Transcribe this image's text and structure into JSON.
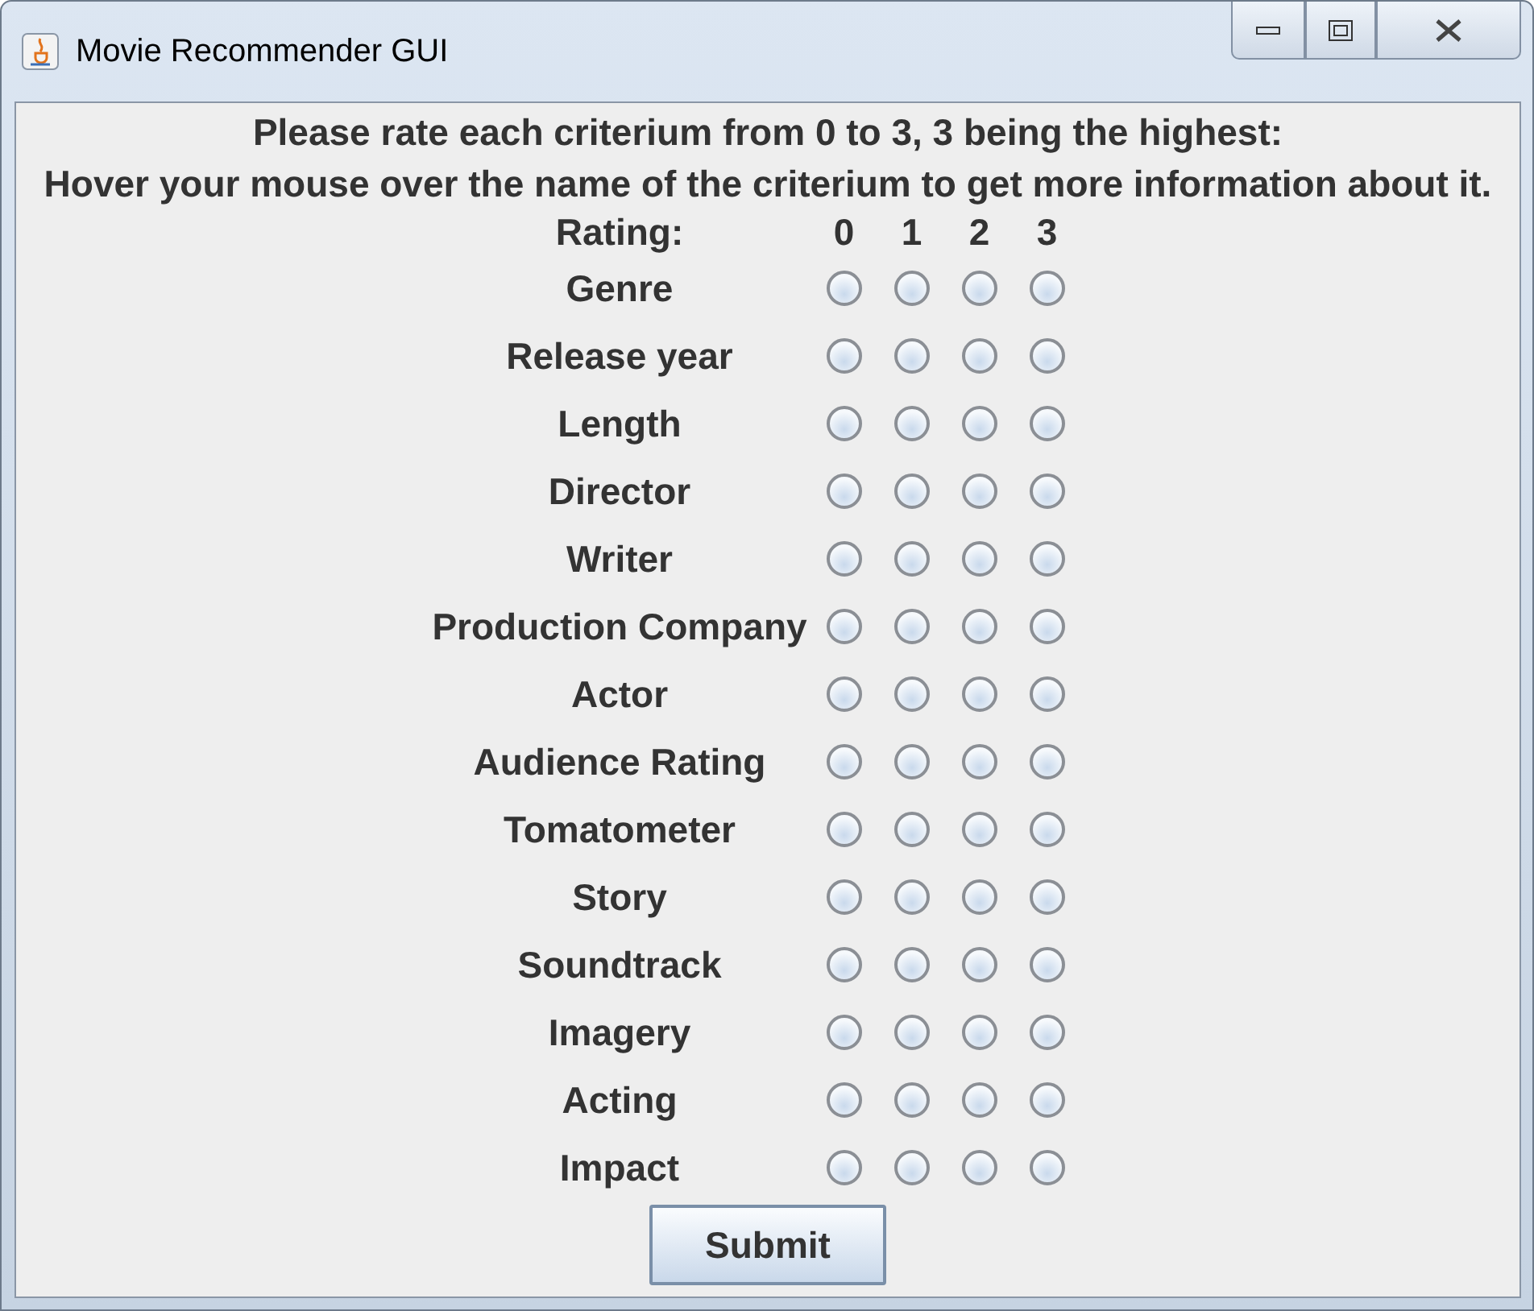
{
  "window": {
    "title": "Movie Recommender GUI"
  },
  "instructions": [
    "Please rate each criterium from 0 to 3, 3 being the highest:",
    "Hover your mouse over the name of the criterium to get more information about it."
  ],
  "rating_header": {
    "label": "Rating:",
    "values": [
      "0",
      "1",
      "2",
      "3"
    ]
  },
  "criteria": [
    {
      "name": "Genre",
      "options": [
        {
          "selected": false
        },
        {
          "selected": false
        },
        {
          "selected": false
        },
        {
          "selected": false
        }
      ]
    },
    {
      "name": "Release year",
      "options": [
        {
          "selected": false
        },
        {
          "selected": false
        },
        {
          "selected": false
        },
        {
          "selected": false
        }
      ]
    },
    {
      "name": "Length",
      "options": [
        {
          "selected": false
        },
        {
          "selected": false
        },
        {
          "selected": false
        },
        {
          "selected": false
        }
      ]
    },
    {
      "name": "Director",
      "options": [
        {
          "selected": false
        },
        {
          "selected": false
        },
        {
          "selected": false
        },
        {
          "selected": false
        }
      ]
    },
    {
      "name": "Writer",
      "options": [
        {
          "selected": false
        },
        {
          "selected": false
        },
        {
          "selected": false
        },
        {
          "selected": false
        }
      ]
    },
    {
      "name": "Production Company",
      "options": [
        {
          "selected": false
        },
        {
          "selected": false
        },
        {
          "selected": false
        },
        {
          "selected": false
        }
      ]
    },
    {
      "name": "Actor",
      "options": [
        {
          "selected": false
        },
        {
          "selected": false
        },
        {
          "selected": false
        },
        {
          "selected": false
        }
      ]
    },
    {
      "name": "Audience Rating",
      "options": [
        {
          "selected": false
        },
        {
          "selected": false
        },
        {
          "selected": false
        },
        {
          "selected": false
        }
      ]
    },
    {
      "name": "Tomatometer",
      "options": [
        {
          "selected": false
        },
        {
          "selected": false
        },
        {
          "selected": false
        },
        {
          "selected": false
        }
      ]
    },
    {
      "name": "Story",
      "options": [
        {
          "selected": false
        },
        {
          "selected": false
        },
        {
          "selected": false
        },
        {
          "selected": false
        }
      ]
    },
    {
      "name": "Soundtrack",
      "options": [
        {
          "selected": false
        },
        {
          "selected": false
        },
        {
          "selected": false
        },
        {
          "selected": false
        }
      ]
    },
    {
      "name": "Imagery",
      "options": [
        {
          "selected": false
        },
        {
          "selected": false
        },
        {
          "selected": false
        },
        {
          "selected": false
        }
      ]
    },
    {
      "name": "Acting",
      "options": [
        {
          "selected": false
        },
        {
          "selected": false
        },
        {
          "selected": false
        },
        {
          "selected": false
        }
      ]
    },
    {
      "name": "Impact",
      "options": [
        {
          "selected": false
        },
        {
          "selected": false
        },
        {
          "selected": false
        },
        {
          "selected": false
        }
      ]
    }
  ],
  "submit_button": "Submit"
}
